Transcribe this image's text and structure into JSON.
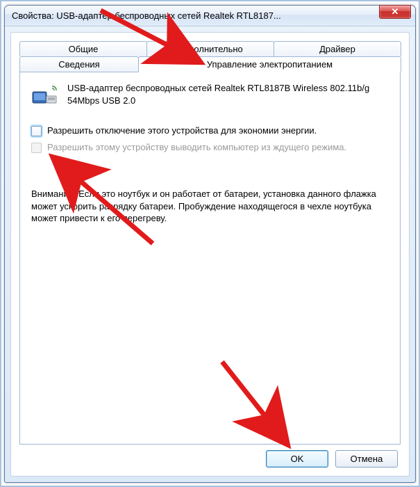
{
  "window": {
    "title": "Свойства: USB-адаптер беспроводных сетей Realtek RTL8187...",
    "close_glyph": "✕"
  },
  "tabs": {
    "row1": [
      {
        "label": "Общие"
      },
      {
        "label": "Дополнительно"
      },
      {
        "label": "Драйвер"
      }
    ],
    "row2": [
      {
        "label": "Сведения"
      },
      {
        "label": "Управление электропитанием",
        "active": true
      }
    ]
  },
  "device": {
    "name": "USB-адаптер беспроводных сетей Realtek RTL8187B Wireless 802.11b/g 54Mbps USB 2.0"
  },
  "checkboxes": {
    "allow_off": {
      "label": "Разрешить отключение этого устройства для экономии энергии.",
      "checked": false,
      "enabled": true
    },
    "allow_wake": {
      "label": "Разрешить этому устройству выводить компьютер из ждущего режима.",
      "checked": false,
      "enabled": false
    }
  },
  "note_text": "Внимание! Если это ноутбук и он работает от батареи, установка данного флажка может ускорить разрядку батареи. Пробуждение находящегося в чехле ноутбука может привести к его перегреву.",
  "buttons": {
    "ok": "OK",
    "cancel": "Отмена"
  },
  "annotations": {
    "arrow_color": "#e11b1b"
  }
}
